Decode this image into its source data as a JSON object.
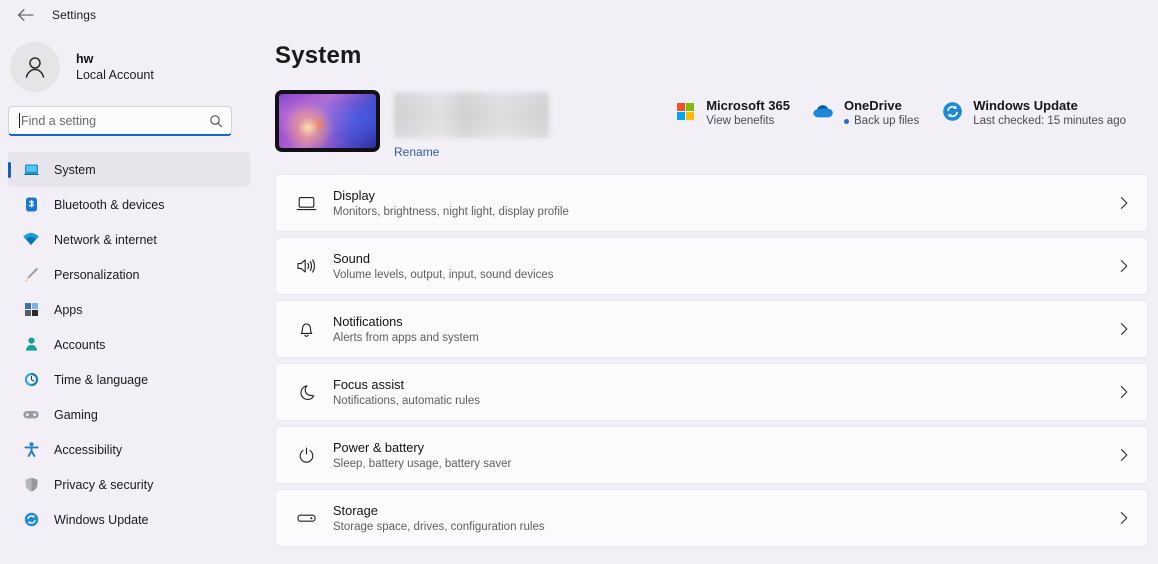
{
  "window": {
    "back_icon": "back-arrow-icon",
    "title": "Settings"
  },
  "account": {
    "avatar_icon": "person-avatar-icon",
    "name": "hw",
    "type": "Local Account"
  },
  "search": {
    "placeholder": "Find a setting",
    "value": "",
    "icon": "search-icon",
    "focused": true
  },
  "sidebar": {
    "items": [
      {
        "label": "System",
        "icon": "monitor-icon",
        "active": true
      },
      {
        "label": "Bluetooth & devices",
        "icon": "bluetooth-icon",
        "active": false
      },
      {
        "label": "Network & internet",
        "icon": "wifi-icon",
        "active": false
      },
      {
        "label": "Personalization",
        "icon": "paintbrush-icon",
        "active": false
      },
      {
        "label": "Apps",
        "icon": "apps-grid-icon",
        "active": false
      },
      {
        "label": "Accounts",
        "icon": "person-icon",
        "active": false
      },
      {
        "label": "Time & language",
        "icon": "clock-icon",
        "active": false
      },
      {
        "label": "Gaming",
        "icon": "gamepad-icon",
        "active": false
      },
      {
        "label": "Accessibility",
        "icon": "accessibility-person-icon",
        "active": false
      },
      {
        "label": "Privacy & security",
        "icon": "shield-icon",
        "active": false
      },
      {
        "label": "Windows Update",
        "icon": "update-sync-icon",
        "active": false
      }
    ]
  },
  "main": {
    "page_title": "System",
    "device": {
      "thumbnail_icon": "device-wallpaper-thumbnail",
      "name_redacted": true,
      "rename_label": "Rename"
    },
    "services": [
      {
        "icon": "microsoft-logo-icon",
        "title": "Microsoft 365",
        "subtitle": "View benefits",
        "has_status_dot": false
      },
      {
        "icon": "onedrive-cloud-icon",
        "title": "OneDrive",
        "subtitle": "Back up files",
        "has_status_dot": true
      },
      {
        "icon": "windows-update-icon",
        "title": "Windows Update",
        "subtitle": "Last checked: 15 minutes ago",
        "has_status_dot": false
      }
    ],
    "rows": [
      {
        "icon": "display-monitor-icon",
        "title": "Display",
        "subtitle": "Monitors, brightness, night light, display profile",
        "chevron": "chevron-right-icon"
      },
      {
        "icon": "sound-speaker-icon",
        "title": "Sound",
        "subtitle": "Volume levels, output, input, sound devices",
        "chevron": "chevron-right-icon"
      },
      {
        "icon": "notifications-bell-icon",
        "title": "Notifications",
        "subtitle": "Alerts from apps and system",
        "chevron": "chevron-right-icon"
      },
      {
        "icon": "focus-assist-moon-icon",
        "title": "Focus assist",
        "subtitle": "Notifications, automatic rules",
        "chevron": "chevron-right-icon"
      },
      {
        "icon": "power-battery-icon",
        "title": "Power & battery",
        "subtitle": "Sleep, battery usage, battery saver",
        "chevron": "chevron-right-icon"
      },
      {
        "icon": "storage-drive-icon",
        "title": "Storage",
        "subtitle": "Storage space, drives, configuration rules",
        "chevron": "chevron-right-icon"
      }
    ]
  },
  "colors": {
    "background": "#f3eff7",
    "card": "#fbfafd",
    "accent": "#0f62b5",
    "link": "#2f5fa8",
    "search_underline": "#1668c8"
  }
}
